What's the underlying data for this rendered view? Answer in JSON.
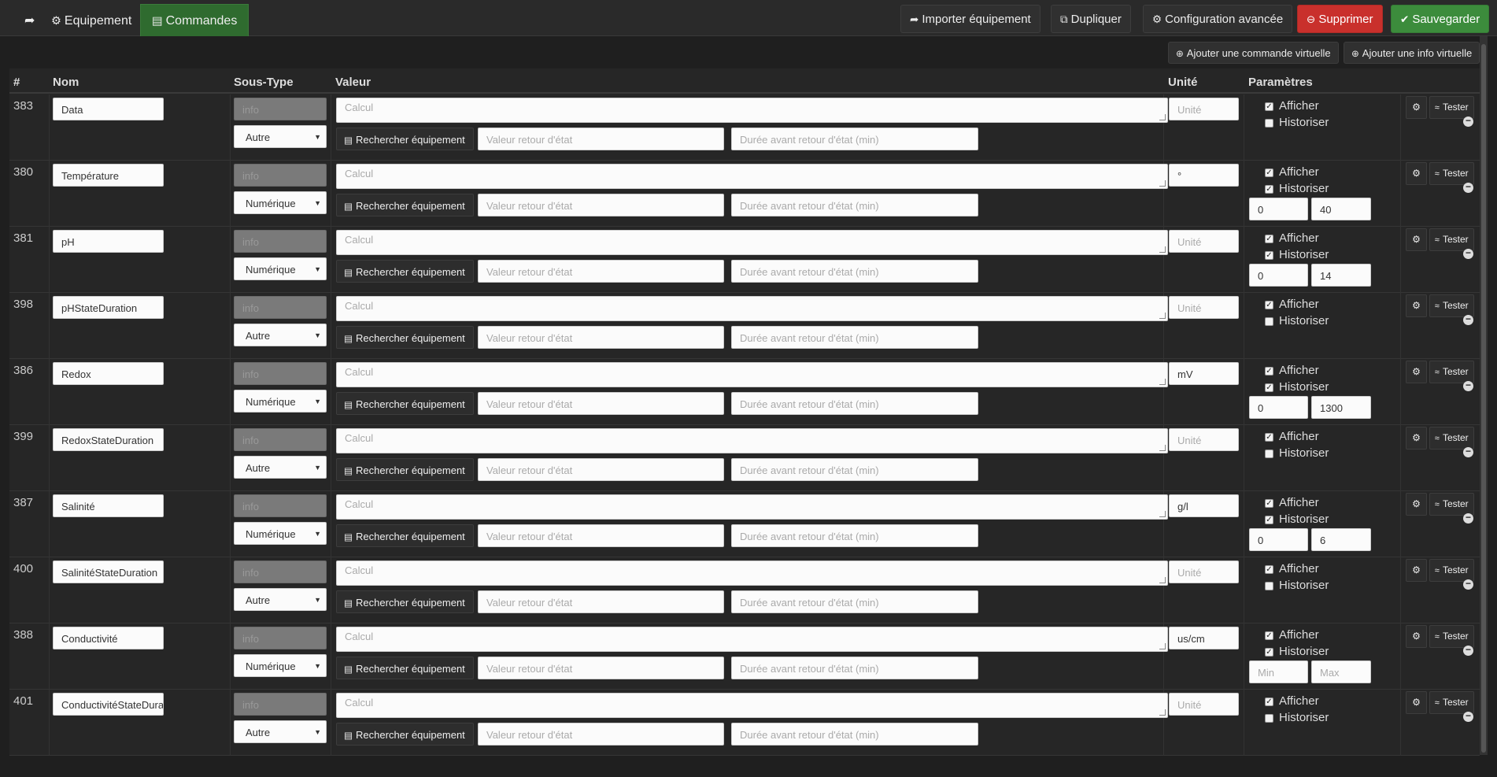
{
  "tabs": {
    "back_icon": "arrow-circle-left-icon",
    "equipement": "Equipement",
    "commandes": "Commandes"
  },
  "toolbar": {
    "importer": "Importer équipement",
    "dupliquer": "Dupliquer",
    "config": "Configuration avancée",
    "supprimer": "Supprimer",
    "sauvegarder": "Sauvegarder",
    "ajouter_commande": "Ajouter une commande virtuelle",
    "ajouter_info": "Ajouter une info virtuelle"
  },
  "table": {
    "headers": {
      "id": "#",
      "nom": "Nom",
      "soustype": "Sous-Type",
      "valeur": "Valeur",
      "unite": "Unité",
      "parametres": "Paramètres"
    },
    "type_value": "info",
    "calc_placeholder": "Calcul",
    "search_label": "Rechercher équipement",
    "retour_placeholder": "Valeur retour d'état",
    "duree_placeholder": "Durée avant retour d'état (min)",
    "unit_placeholder": "Unité",
    "afficher_label": "Afficher",
    "historiser_label": "Historiser",
    "tester_label": "Tester",
    "min_placeholder": "Min",
    "max_placeholder": "Max",
    "rows": [
      {
        "id": "383",
        "name": "Data",
        "subtype": "Autre",
        "unit": "",
        "afficher": true,
        "historiser": false,
        "minmax": false,
        "min": "",
        "max": ""
      },
      {
        "id": "380",
        "name": "Température",
        "subtype": "Numérique",
        "unit": "°",
        "afficher": true,
        "historiser": true,
        "minmax": true,
        "min": "0",
        "max": "40"
      },
      {
        "id": "381",
        "name": "pH",
        "subtype": "Numérique",
        "unit": "",
        "afficher": true,
        "historiser": true,
        "minmax": true,
        "min": "0",
        "max": "14"
      },
      {
        "id": "398",
        "name": "pHStateDuration",
        "subtype": "Autre",
        "unit": "",
        "afficher": true,
        "historiser": false,
        "minmax": false,
        "min": "",
        "max": ""
      },
      {
        "id": "386",
        "name": "Redox",
        "subtype": "Numérique",
        "unit": "mV",
        "afficher": true,
        "historiser": true,
        "minmax": true,
        "min": "0",
        "max": "1300"
      },
      {
        "id": "399",
        "name": "RedoxStateDuration",
        "subtype": "Autre",
        "unit": "",
        "afficher": true,
        "historiser": false,
        "minmax": false,
        "min": "",
        "max": ""
      },
      {
        "id": "387",
        "name": "Salinité",
        "subtype": "Numérique",
        "unit": "g/l",
        "afficher": true,
        "historiser": true,
        "minmax": true,
        "min": "0",
        "max": "6"
      },
      {
        "id": "400",
        "name": "SalinitéStateDuration",
        "subtype": "Autre",
        "unit": "",
        "afficher": true,
        "historiser": false,
        "minmax": false,
        "min": "",
        "max": ""
      },
      {
        "id": "388",
        "name": "Conductivité",
        "subtype": "Numérique",
        "unit": "us/cm",
        "afficher": true,
        "historiser": true,
        "minmax": true,
        "min": "",
        "max": ""
      },
      {
        "id": "401",
        "name": "ConductivitéStateDuration",
        "subtype": "Autre",
        "unit": "",
        "afficher": true,
        "historiser": false,
        "minmax": false,
        "min": "",
        "max": ""
      }
    ]
  },
  "colors": {
    "primary": "#2f6b2f",
    "danger": "#c9302c",
    "success": "#3c8c3c",
    "background": "#1f1f1f"
  }
}
